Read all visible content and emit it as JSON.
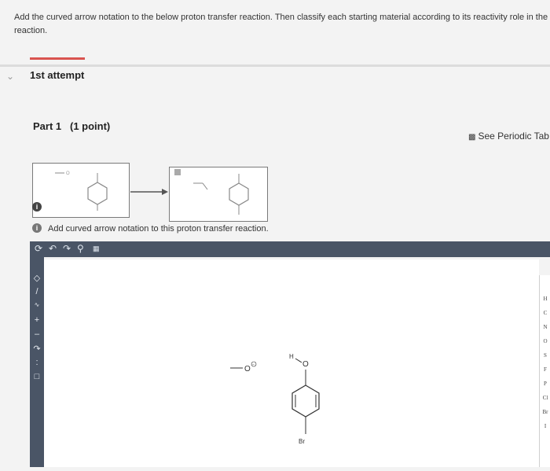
{
  "question": {
    "text": "Add the curved arrow notation to the below proton transfer reaction. Then classify each starting material according to its reactivity role in the reaction."
  },
  "attempt": {
    "label": "1st attempt"
  },
  "part": {
    "label": "Part 1",
    "points": "(1 point)"
  },
  "periodic_link": {
    "label": "See Periodic Tab"
  },
  "instruction": {
    "text": "Add curved arrow notation to this proton transfer reaction."
  },
  "canvas_molecules": {
    "anion_label": "O",
    "phenol_h": "H",
    "phenol_o": "O",
    "bromine": "Br"
  },
  "element_palette": [
    "H",
    "C",
    "N",
    "O",
    "S",
    "F",
    "P",
    "Cl",
    "Br",
    "I"
  ],
  "colors": {
    "toolbar": "#4a5566",
    "accent_red": "#d9534f"
  },
  "icons": [
    "chevron-down-icon",
    "periodic-table-icon",
    "info-icon",
    "undo-icon",
    "redo-icon",
    "zoom-icon",
    "reset-icon",
    "eraser-icon",
    "bond-icon",
    "charge-plus-icon",
    "charge-minus-icon",
    "lone-pair-icon",
    "curved-arrow-icon",
    "box-select-icon"
  ]
}
